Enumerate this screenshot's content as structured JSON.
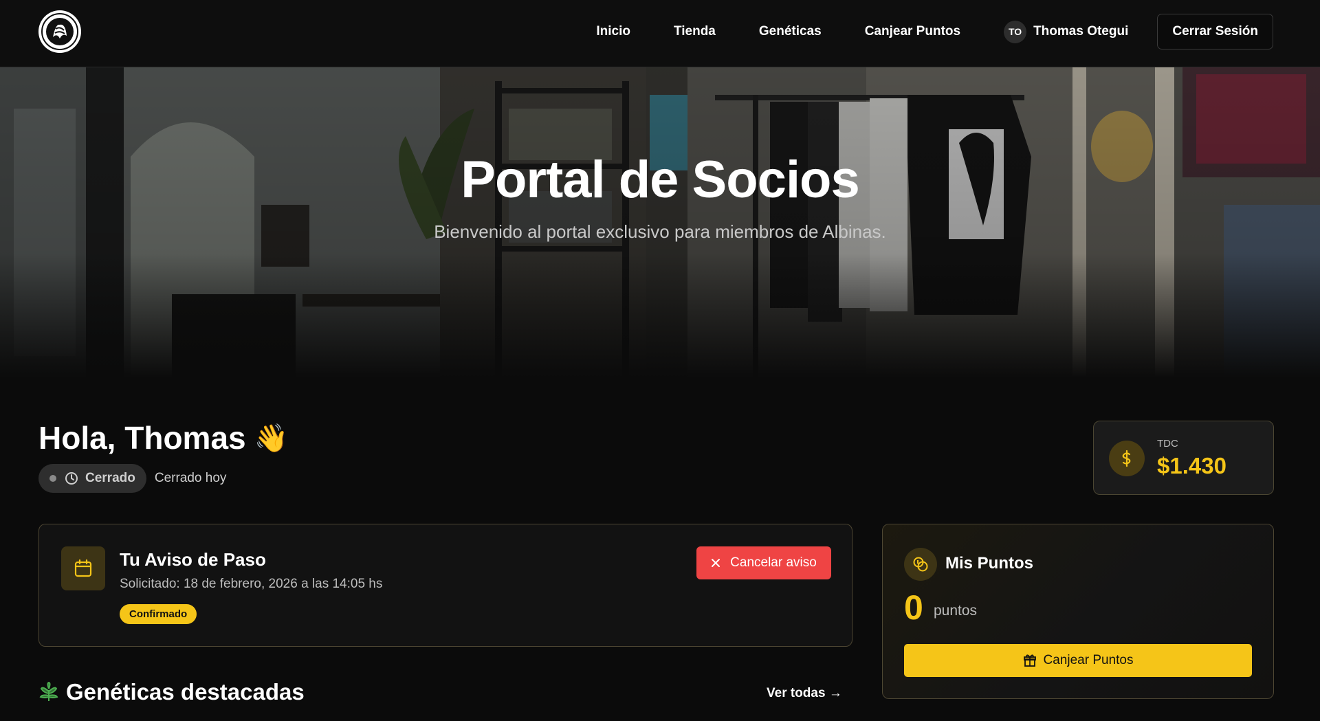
{
  "nav": {
    "logo_alt": "ALBINAS",
    "links": [
      "Inicio",
      "Tienda",
      "Genéticas",
      "Canjear Puntos"
    ],
    "user_initials": "TO",
    "user_name": "Thomas Otegui",
    "logout_label": "Cerrar Sesión"
  },
  "hero": {
    "title": "Portal de Socios",
    "subtitle": "Bienvenido al portal exclusivo para miembros de Albinas."
  },
  "greeting": {
    "text": "Hola, Thomas",
    "emoji": "👋",
    "status_label": "Cerrado",
    "status_note": "Cerrado hoy"
  },
  "tdc": {
    "label": "TDC",
    "value": "$1.430",
    "icon": "dollar-icon"
  },
  "aviso": {
    "title": "Tu Aviso de Paso",
    "requested": "Solicitado: 18 de febrero, 2026 a las 14:05 hs",
    "badge": "Confirmado",
    "cancel_label": "Cancelar aviso",
    "icon": "calendar-icon"
  },
  "puntos": {
    "title": "Mis Puntos",
    "value": "0",
    "unit": "puntos",
    "button_label": "Canjear Puntos",
    "icon": "coins-icon"
  },
  "geneticas": {
    "title": "Genéticas destacadas",
    "see_all": "Ver todas →",
    "icon": "leaf-icon"
  },
  "colors": {
    "accent": "#f5c518",
    "danger": "#ef4444",
    "background": "#0b0b0b"
  }
}
